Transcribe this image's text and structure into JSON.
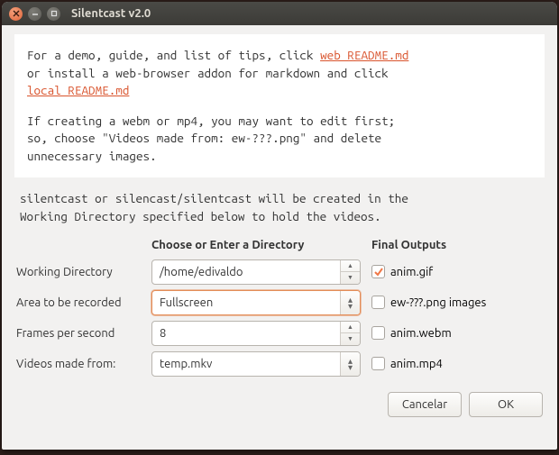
{
  "titlebar": {
    "title": "Silentcast v2.0"
  },
  "intro": {
    "line1a": "For a demo, guide, and list of tips, click ",
    "link1": "web README.md",
    "line2a": "or install a web-browser addon for markdown and click",
    "link2": "local README.md",
    "line4": "If creating a webm or mp4, you may want to edit first;",
    "line5": "so, choose \"Videos made from: ew-???.png\" and delete",
    "line6": "unnecessary images."
  },
  "note": {
    "line1": "silentcast or silencast/silentcast will be created in the",
    "line2": "Working Directory specified below to hold the videos."
  },
  "headers": {
    "dir": "Choose or Enter a Directory",
    "outputs": "Final Outputs"
  },
  "form": {
    "working_dir_label": "Working Directory",
    "working_dir_value": "/home/edivaldo",
    "area_label": "Area to be recorded",
    "area_value": "Fullscreen",
    "fps_label": "Frames per second",
    "fps_value": "8",
    "videos_label": "Videos made from:",
    "videos_value": "temp.mkv"
  },
  "outputs": {
    "anim_gif": {
      "label": "anim.gif",
      "checked": true
    },
    "ew_png": {
      "label": "ew-???.png images",
      "checked": false
    },
    "anim_webm": {
      "label": "anim.webm",
      "checked": false
    },
    "anim_mp4": {
      "label": "anim.mp4",
      "checked": false
    }
  },
  "buttons": {
    "cancel": "Cancelar",
    "ok": "OK"
  },
  "colors": {
    "accent": "#e2663b",
    "check": "#f07746"
  }
}
